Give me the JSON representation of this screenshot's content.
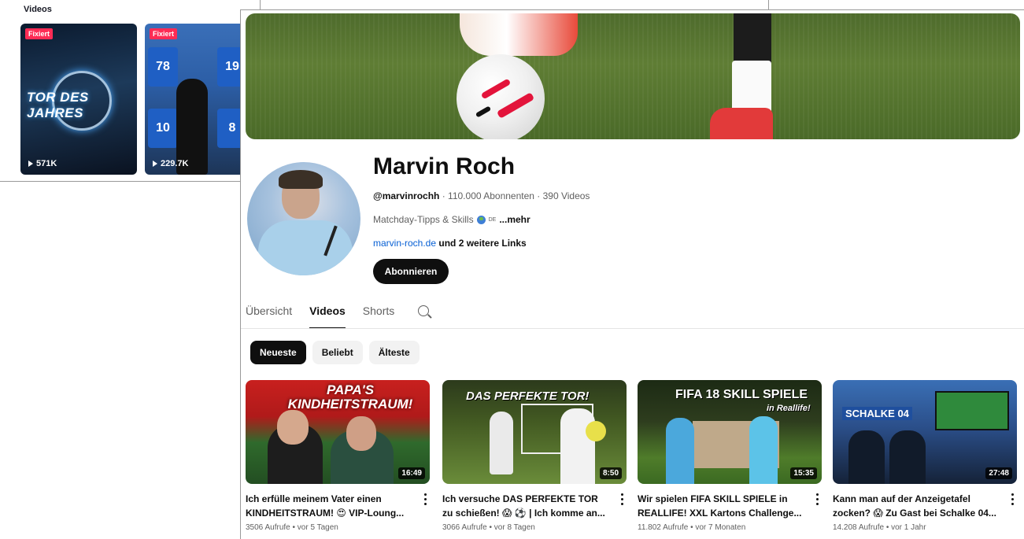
{
  "tiktok": {
    "heading": "Videos",
    "cards": [
      {
        "badge": "Fixiert",
        "views": "571K",
        "overlay_text": "TOR DES JAHRES"
      },
      {
        "badge": "Fixiert",
        "views": "229.7K",
        "jersey_numbers": [
          "78",
          "19",
          "10",
          "8"
        ]
      }
    ]
  },
  "channel": {
    "name": "Marvin Roch",
    "handle": "@marvinrochh",
    "stats": " · 110.000 Abonnenten · 390 Videos",
    "description": "Matchday-Tipps & Skills",
    "description_flag": "DE",
    "more": "...mehr",
    "link": "marvin-roch.de",
    "link_suffix": " und 2 weitere Links",
    "subscribe_label": "Abonnieren"
  },
  "tabs": [
    {
      "label": "Übersicht",
      "active": false
    },
    {
      "label": "Videos",
      "active": true
    },
    {
      "label": "Shorts",
      "active": false
    }
  ],
  "filters": [
    {
      "label": "Neueste",
      "active": true
    },
    {
      "label": "Beliebt",
      "active": false
    },
    {
      "label": "Älteste",
      "active": false
    }
  ],
  "videos": [
    {
      "thumb_text": "PAPA'S KINDHEITSTRAUM!",
      "duration": "16:49",
      "title_line1": "Ich erfülle meinem Vater einen",
      "title_line2": "KINDHEITSTRAUM! 😍 VIP-Loung...",
      "meta": "3506 Aufrufe • vor 5 Tagen"
    },
    {
      "thumb_text": "DAS PERFEKTE TOR!",
      "duration": "8:50",
      "title_line1": "Ich versuche DAS PERFEKTE TOR",
      "title_line2": "zu schießen! 😱 ⚽ | Ich komme an...",
      "meta": "3066 Aufrufe • vor 8 Tagen"
    },
    {
      "thumb_text": "FIFA 18 SKILL SPIELE",
      "thumb_subtext": "in Reallife!",
      "duration": "15:35",
      "title_line1": "Wir spielen FIFA SKILL SPIELE in",
      "title_line2": "REALLIFE! XXL Kartons Challenge...",
      "meta": "11.802 Aufrufe • vor 7 Monaten"
    },
    {
      "thumb_text": "SCHALKE 04",
      "duration": "27:48",
      "title_line1": "Kann man auf der Anzeigetafel",
      "title_line2": "zocken? 😱 Zu Gast bei Schalke 04...",
      "meta": "14.208 Aufrufe • vor 1 Jahr"
    }
  ],
  "colors": {
    "accent": "#0f0f0f",
    "link": "#065fd4",
    "badge": "#fe2c55"
  }
}
